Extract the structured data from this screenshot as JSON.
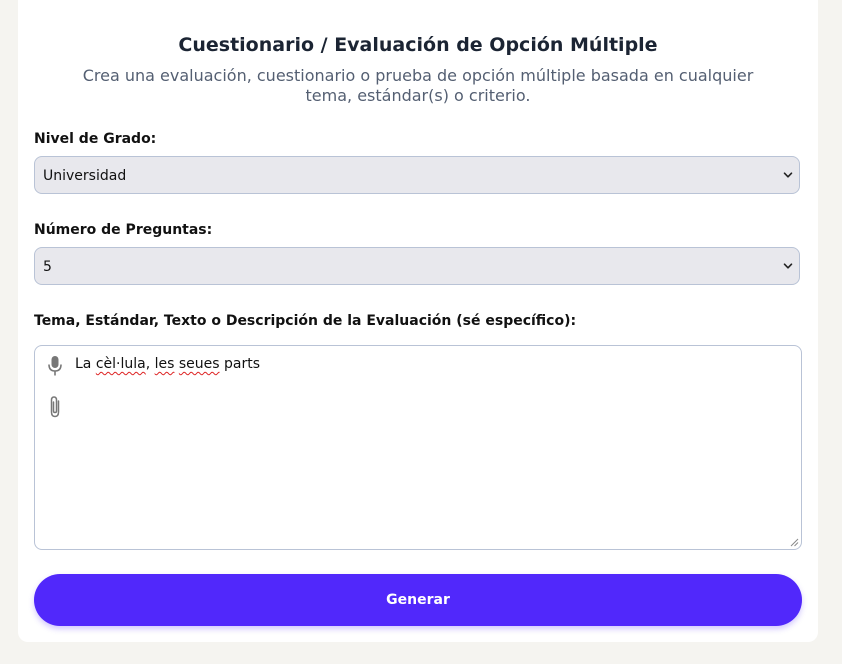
{
  "header": {
    "title": "Cuestionario / Evaluación de Opción Múltiple",
    "subtitle": "Crea una evaluación, cuestionario o prueba de opción múltiple basada en cualquier tema, estándar(s) o criterio."
  },
  "form": {
    "grade": {
      "label": "Nivel de Grado:",
      "value": "Universidad",
      "icon": "chevron-down-icon"
    },
    "questions": {
      "label": "Número de Preguntas:",
      "value": "5",
      "icon": "chevron-down-icon"
    },
    "topic": {
      "label": "Tema, Estándar, Texto o Descripción de la Evaluación (sé específico):",
      "value_part1": "La ",
      "value_word1": "cèl·lula",
      "value_part2": ", ",
      "value_word2": "les",
      "value_part3": " ",
      "value_word3": "seues",
      "value_part4": " parts",
      "icons": [
        "microphone-icon",
        "paperclip-icon"
      ]
    },
    "generate_label": "Generar"
  },
  "colors": {
    "accent": "#5128fb",
    "select_bg": "#e8e8ed",
    "border": "#b9c3d6",
    "title": "#1b2433",
    "subtitle": "#545f72"
  }
}
